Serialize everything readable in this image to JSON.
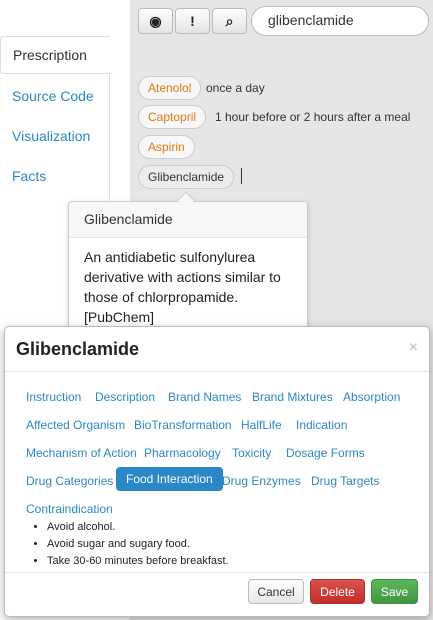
{
  "toolbar": {
    "view_icon_glyph": "◉",
    "alert_icon_glyph": "!",
    "search_icon_glyph": "⌕",
    "search_value": "glibenclamide"
  },
  "sidebar": {
    "items": [
      {
        "label": "Prescription"
      },
      {
        "label": "Source Code"
      },
      {
        "label": "Visualization"
      },
      {
        "label": "Facts"
      }
    ]
  },
  "prescription": {
    "drugs": [
      {
        "name": "Atenolol",
        "note": "once a day"
      },
      {
        "name": "Captopril",
        "note": "1 hour before or 2 hours after a meal"
      },
      {
        "name": "Aspirin",
        "note": ""
      },
      {
        "name": "Glibenclamide",
        "note": ""
      }
    ]
  },
  "popover": {
    "title": "Glibenclamide",
    "body": "An antidiabetic sulfonylurea derivative with actions similar to those of chlorpropamide. [PubChem]"
  },
  "modal": {
    "title": "Glibenclamide",
    "close_glyph": "×",
    "tabs": [
      {
        "label": "Instruction"
      },
      {
        "label": "Description"
      },
      {
        "label": "Brand Names"
      },
      {
        "label": "Brand Mixtures"
      },
      {
        "label": "Absorption"
      },
      {
        "label": "Affected Organism"
      },
      {
        "label": "BioTransformation"
      },
      {
        "label": "HalfLife"
      },
      {
        "label": "Indication"
      },
      {
        "label": "Mechanism of Action"
      },
      {
        "label": "Pharmacology"
      },
      {
        "label": "Toxicity"
      },
      {
        "label": "Dosage Forms"
      },
      {
        "label": "Drug Categories"
      },
      {
        "label": "Food Interaction"
      },
      {
        "label": "Drug Enzymes"
      },
      {
        "label": "Drug Targets"
      },
      {
        "label": "Contraindication"
      }
    ],
    "active_tab": "Food Interaction",
    "content": [
      "Avoid alcohol.",
      "Avoid sugar and sugary food.",
      "Take 30-60 minutes before breakfast."
    ],
    "buttons": {
      "cancel": "Cancel",
      "delete": "Delete",
      "save": "Save"
    }
  },
  "colors": {
    "link": "#2a88c8",
    "drug_name": "#e07a10",
    "danger": "#d9534f",
    "success": "#5cb85c"
  }
}
